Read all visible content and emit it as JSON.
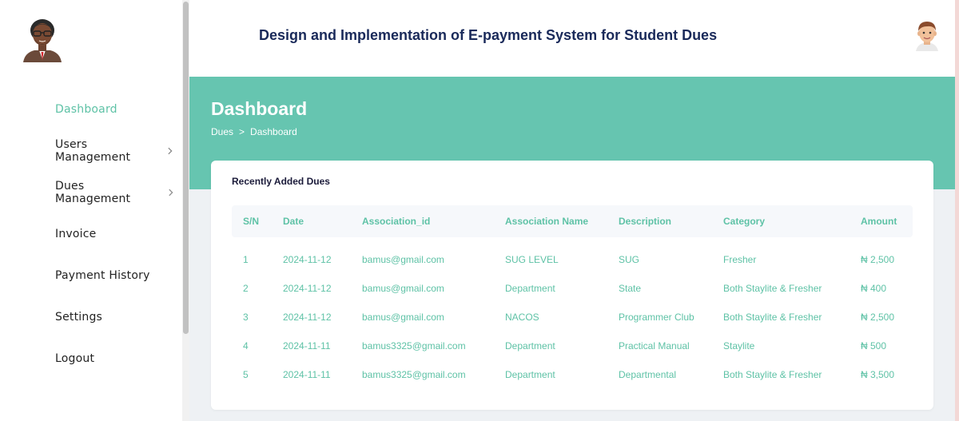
{
  "app": {
    "title": "Design and Implementation of E-payment System for Student Dues"
  },
  "sidebar": {
    "items": [
      {
        "label": "Dashboard",
        "active": true,
        "has_chevron": false
      },
      {
        "label": "Users Management",
        "active": false,
        "has_chevron": true
      },
      {
        "label": "Dues Management",
        "active": false,
        "has_chevron": true
      },
      {
        "label": "Invoice",
        "active": false,
        "has_chevron": false
      },
      {
        "label": "Payment History",
        "active": false,
        "has_chevron": false
      },
      {
        "label": "Settings",
        "active": false,
        "has_chevron": false
      },
      {
        "label": "Logout",
        "active": false,
        "has_chevron": false
      }
    ]
  },
  "hero": {
    "title": "Dashboard",
    "breadcrumb": {
      "root": "Dues",
      "separator": ">",
      "current": "Dashboard"
    }
  },
  "card": {
    "title": "Recently Added Dues",
    "columns": [
      "S/N",
      "Date",
      "Association_id",
      "Association Name",
      "Description",
      "Category",
      "Amount"
    ],
    "rows": [
      [
        "1",
        "2024-11-12",
        "bamus@gmail.com",
        "SUG LEVEL",
        "SUG",
        "Fresher",
        "₦ 2,500"
      ],
      [
        "2",
        "2024-11-12",
        "bamus@gmail.com",
        "Department",
        "State",
        "Both Staylite & Fresher",
        "₦ 400"
      ],
      [
        "3",
        "2024-11-12",
        "bamus@gmail.com",
        "NACOS",
        "Programmer Club",
        "Both Staylite & Fresher",
        "₦ 2,500"
      ],
      [
        "4",
        "2024-11-11",
        "bamus3325@gmail.com",
        "Department",
        "Practical Manual",
        "Staylite",
        "₦ 500"
      ],
      [
        "5",
        "2024-11-11",
        "bamus3325@gmail.com",
        "Department",
        "Departmental",
        "Both Staylite & Fresher",
        "₦ 3,500"
      ]
    ]
  },
  "colors": {
    "accent": "#66c5b0",
    "text_accent": "#5ec2a6",
    "title_navy": "#1a2a5a"
  },
  "icons": {
    "sidebar_avatar": "avatar-man-glasses-icon",
    "user_avatar": "avatar-man-icon",
    "chevron": "chevron-right-icon"
  }
}
